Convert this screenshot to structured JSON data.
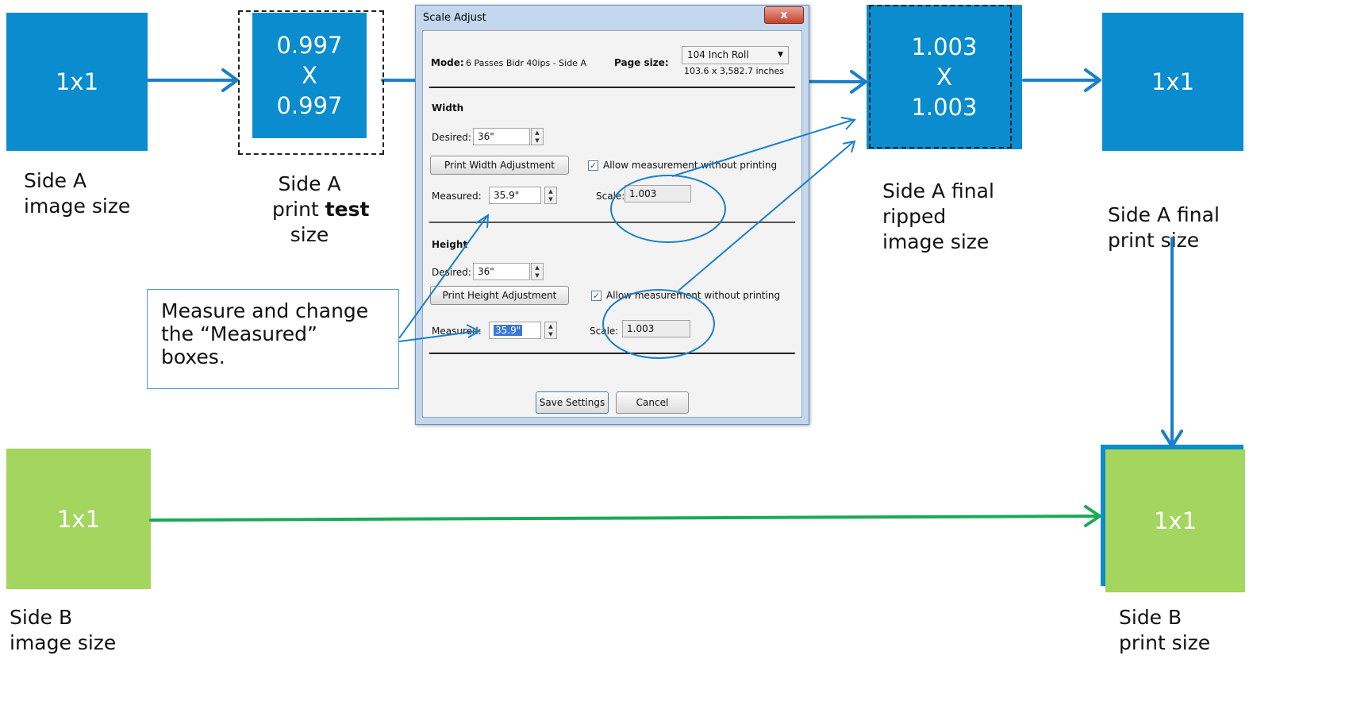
{
  "boxes": {
    "side_a_image": "1x1",
    "test_top": "0.997",
    "test_mid": "X",
    "test_bottom": "0.997",
    "ripped_top": "1.003",
    "ripped_mid": "X",
    "ripped_bottom": "1.003",
    "side_a_final_print": "1x1",
    "side_b_image": "1x1",
    "side_b_print": "1x1"
  },
  "captions": {
    "side_a_image_l1": "Side A",
    "side_a_image_l2": "image size",
    "print_test_l1": "Side A",
    "print_test_l2_pre": "print ",
    "print_test_l2_bold": "test",
    "print_test_l3": "size",
    "ripped_l1": "Side A final",
    "ripped_l2": "ripped",
    "ripped_l3": "image size",
    "final_print_l1": "Side A final",
    "final_print_l2": "print size",
    "side_b_image_l1": "Side B",
    "side_b_image_l2": "image size",
    "side_b_print_l1": "Side B",
    "side_b_print_l2": "print size"
  },
  "callout": {
    "line1": "Measure and change",
    "line2": "the “Measured”",
    "line3": "boxes."
  },
  "dialog": {
    "title": "Scale Adjust",
    "close_label": "x",
    "mode_label": "Mode:",
    "mode_value": "6 Passes Bidr 40ips - Side A",
    "page_size_label": "Page size:",
    "page_size_value": "104 Inch Roll",
    "page_size_dims": "103.6 x 3,582.7 inches",
    "width_section": "Width",
    "height_section": "Height",
    "desired_label": "Desired:",
    "width_desired": "36\"",
    "height_desired": "36\"",
    "print_width_button": "Print Width Adjustment",
    "print_height_button": "Print Height Adjustment",
    "allow_label": "Allow measurement without printing",
    "measured_label": "Measured:",
    "width_measured": "35.9\"",
    "height_measured": "35.9\"",
    "scale_label": "Scale:",
    "width_scale": "1.003",
    "height_scale": "1.003",
    "save_button": "Save Settings",
    "cancel_button": "Cancel"
  },
  "colors": {
    "blue": "#0a8ccf",
    "green": "#a4d55f",
    "arrow_blue": "#1a7fc8",
    "arrow_green": "#1aaa55"
  }
}
